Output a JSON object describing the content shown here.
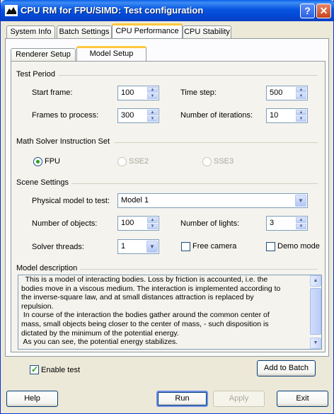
{
  "window": {
    "title": "CPU RM for FPU/SIMD: Test configuration",
    "help_glyph": "?",
    "close_glyph": "✕"
  },
  "tabs": [
    {
      "label": "System Info"
    },
    {
      "label": "Batch Settings"
    },
    {
      "label": "CPU Performance"
    },
    {
      "label": "CPU Stability"
    }
  ],
  "active_tab": "CPU Performance",
  "subtabs": [
    {
      "label": "Renderer Setup"
    },
    {
      "label": "Model Setup"
    }
  ],
  "active_subtab": "Model Setup",
  "test_period": {
    "heading": "Test Period",
    "start_frame_label": "Start frame:",
    "start_frame_value": "100",
    "time_step_label": "Time step:",
    "time_step_value": "500",
    "frames_label": "Frames to process:",
    "frames_value": "300",
    "iterations_label": "Number of iterations:",
    "iterations_value": "10"
  },
  "math_solver": {
    "heading": "Math Solver Instruction Set",
    "options": [
      {
        "label": "FPU",
        "checked": true,
        "enabled": true
      },
      {
        "label": "SSE2",
        "checked": false,
        "enabled": false
      },
      {
        "label": "SSE3",
        "checked": false,
        "enabled": false
      }
    ]
  },
  "scene": {
    "heading": "Scene Settings",
    "model_label": "Physical model to test:",
    "model_value": "Model 1",
    "objects_label": "Number of objects:",
    "objects_value": "100",
    "lights_label": "Number of lights:",
    "lights_value": "3",
    "threads_label": "Solver threads:",
    "threads_value": "1",
    "free_camera_label": "Free camera",
    "free_camera_checked": false,
    "demo_mode_label": "Demo mode",
    "demo_mode_checked": false
  },
  "description": {
    "heading": "Model description",
    "lines": [
      "  This is a model of interacting bodies. Loss by friction is accounted, i.e. the",
      "bodies move in a viscous medium. The interaction is implemented according to",
      "the inverse-square law, and at small distances attraction is replaced by",
      "repulsion.",
      " In course of the interaction the bodies gather around the common center of",
      "mass, small objects being closer to the center of mass, - such disposition is",
      "dictated by the minimum of the potential energy.",
      " As you can see, the potential energy stabilizes."
    ]
  },
  "enable_test": {
    "label": "Enable test",
    "checked": true
  },
  "buttons": {
    "add_to_batch": "Add to Batch",
    "help": "Help",
    "run": "Run",
    "apply": "Apply",
    "exit": "Exit"
  },
  "colors": {
    "title_bar": "#0654e0",
    "dialog_bg": "#ece9d8",
    "active_tab_accent": "#ffc83c",
    "radio_check": "#21a121"
  },
  "icons": {
    "spin_up": "▲",
    "spin_down": "▼",
    "combo_arrow": "▼"
  }
}
